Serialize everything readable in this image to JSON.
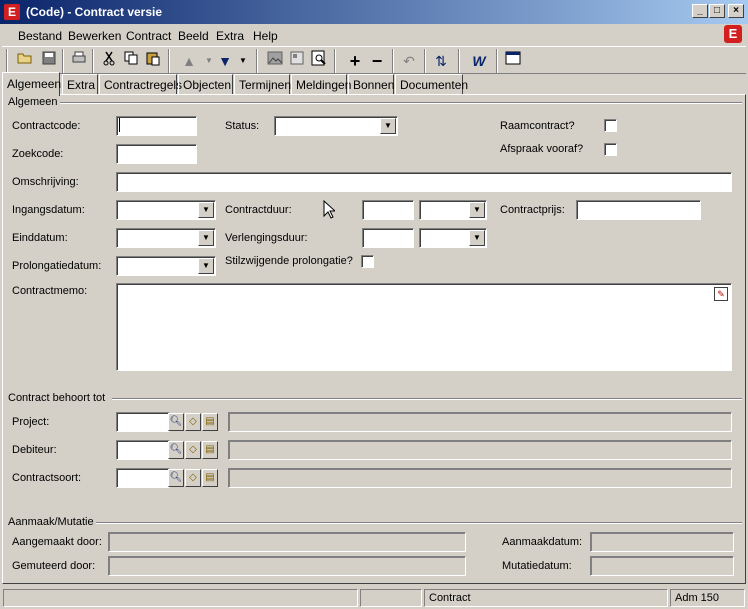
{
  "window": {
    "title": "(Code) - Contract versie",
    "app_icon": "E",
    "minimize": "_",
    "maximize": "□",
    "close": "×"
  },
  "menu": [
    "Bestand",
    "Bewerken",
    "Contract",
    "Beeld",
    "Extra",
    "Help"
  ],
  "menu_logo": "E",
  "toolbar_icons": [
    "open-folder-icon",
    "save-icon",
    "print-icon",
    "cut-icon",
    "copy-icon",
    "paste-icon",
    "arrow-up-icon",
    "arrow-down-icon",
    "image-icon",
    "record-icon",
    "zoom-icon",
    "plus-icon",
    "minus-icon",
    "undo-icon",
    "refresh-icon",
    "word-icon",
    "window-icon"
  ],
  "tabs": [
    "Algemeen",
    "Extra",
    "Contractregels",
    "Objecten",
    "Termijnen",
    "Meldingen",
    "Bonnen",
    "Documenten"
  ],
  "active_tab": "Algemeen",
  "form": {
    "group_general": "Algemeen",
    "contractcode_label": "Contractcode:",
    "contractcode_value": "",
    "status_label": "Status:",
    "status_value": "",
    "raamcontract_label": "Raamcontract?",
    "afspraak_label": "Afspraak vooraf?",
    "zoekcode_label": "Zoekcode:",
    "zoekcode_value": "",
    "omschrijving_label": "Omschrijving:",
    "omschrijving_value": "",
    "ingangsdatum_label": "Ingangsdatum:",
    "contractduur_label": "Contractduur:",
    "contractprijs_label": "Contractprijs:",
    "einddatum_label": "Einddatum:",
    "verlengingsduur_label": "Verlengingsduur:",
    "prolongatiedatum_label": "Prolongatiedatum:",
    "stilzwijgende_label": "Stilzwijgende prolongatie?",
    "contractmemo_label": "Contractmemo:",
    "contractmemo_value": ""
  },
  "belongs": {
    "group": "Contract behoort tot",
    "project_label": "Project:",
    "debiteur_label": "Debiteur:",
    "contractsoort_label": "Contractsoort:"
  },
  "audit": {
    "group": "Aanmaak/Mutatie",
    "aangemaakt_label": "Aangemaakt door:",
    "gemuteerd_label": "Gemuteerd door:",
    "aanmaakdatum_label": "Aanmaakdatum:",
    "mutatiedatum_label": "Mutatiedatum:"
  },
  "statusbar": {
    "panel1": "",
    "panel2": "",
    "panel3": "Contract",
    "panel4": "Adm 150"
  },
  "colors": {
    "titlebar_start": "#0a246a",
    "titlebar_end": "#a6caf0",
    "brand_red": "#d21f1f",
    "face": "#d4d0c8"
  }
}
